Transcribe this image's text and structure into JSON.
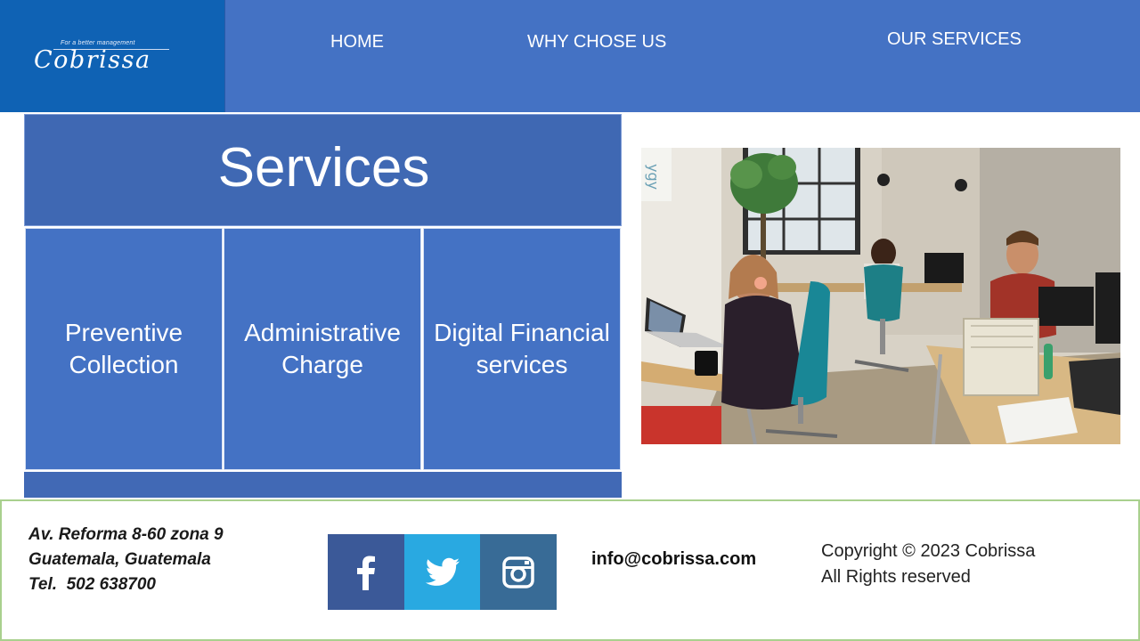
{
  "header": {
    "logo_tagline": "For a better management",
    "logo_name": "Cobrissa",
    "nav": [
      "HOME",
      "WHY CHOSE US",
      "OUR SERVICES"
    ]
  },
  "services": {
    "title": "Services",
    "cards": [
      {
        "label": "Preventive Collection"
      },
      {
        "label": "Administrative Charge"
      },
      {
        "label": "Digital Financial services"
      }
    ]
  },
  "photo": {
    "sign_text": "ygy"
  },
  "footer": {
    "address_lines": [
      "Av. Reforma 8-60 zona 9",
      "Guatemala, Guatemala",
      "Tel.  502 638700"
    ],
    "social": [
      "facebook-icon",
      "twitter-icon",
      "instagram-icon"
    ],
    "email": "info@cobrissa.com",
    "copyright_lines": [
      "Copyright © 2023 Cobrissa",
      "All Rights reserved"
    ]
  },
  "colors": {
    "header_bg": "#4472c4",
    "logo_bg": "#0f62b4",
    "services_title_bg": "#3f68b3",
    "card_bg": "#4472c4",
    "facebook": "#3b5998",
    "twitter": "#29a9e1",
    "instagram": "#386b96",
    "footer_border": "#a9d08e"
  }
}
